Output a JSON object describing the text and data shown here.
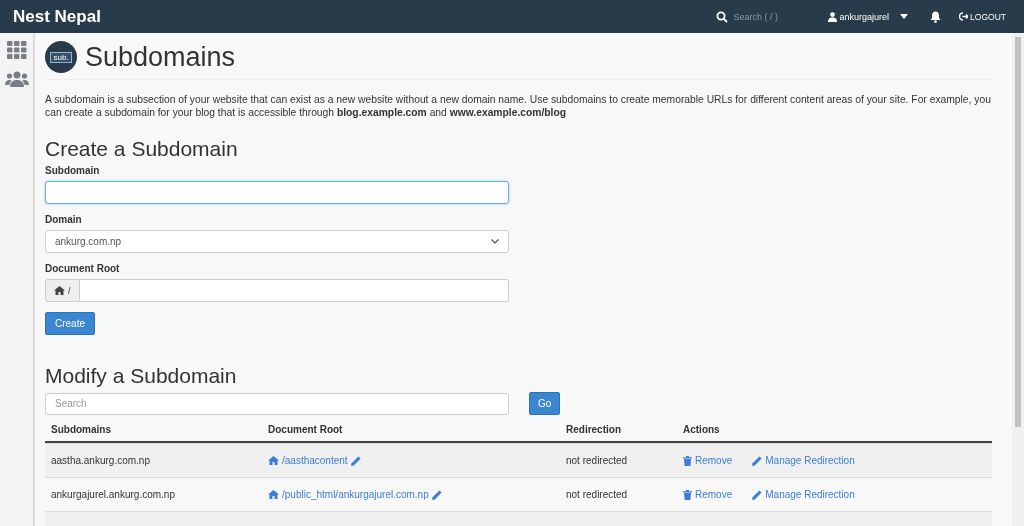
{
  "topbar": {
    "brand": "Nest Nepal",
    "search_placeholder": "Search ( / )",
    "user": "ankurgajurel",
    "logout": "LOGOUT"
  },
  "page": {
    "title": "Subdomains",
    "badge": "sub.",
    "intro": "A subdomain is a subsection of your website that can exist as a new website without a new domain name. Use subdomains to create memorable URLs for different content areas of your site. For example, you can create a subdomain for your blog that is accessible through **blog.example.com** and **www.example.com/blog**"
  },
  "create": {
    "heading": "Create a Subdomain",
    "subdomain_label": "Subdomain",
    "domain_label": "Domain",
    "domain_value": "ankurg.com.np",
    "docroot_label": "Document Root",
    "docroot_prefix": "/",
    "button": "Create"
  },
  "modify": {
    "heading": "Modify a Subdomain",
    "search_placeholder": "Search",
    "go": "Go",
    "columns": [
      "Subdomains",
      "Document Root",
      "Redirection",
      "Actions"
    ],
    "rows": [
      {
        "subdomain": "aastha.ankurg.com.np",
        "docroot": "/aasthacontent",
        "redirection": "not redirected",
        "remove": "Remove",
        "manage": "Manage Redirection"
      },
      {
        "subdomain": "ankurgajurel.ankurg.com.np",
        "docroot": "/public_html/ankurgajurel.com.np",
        "redirection": "not redirected",
        "remove": "Remove",
        "manage": "Manage Redirection"
      }
    ]
  }
}
